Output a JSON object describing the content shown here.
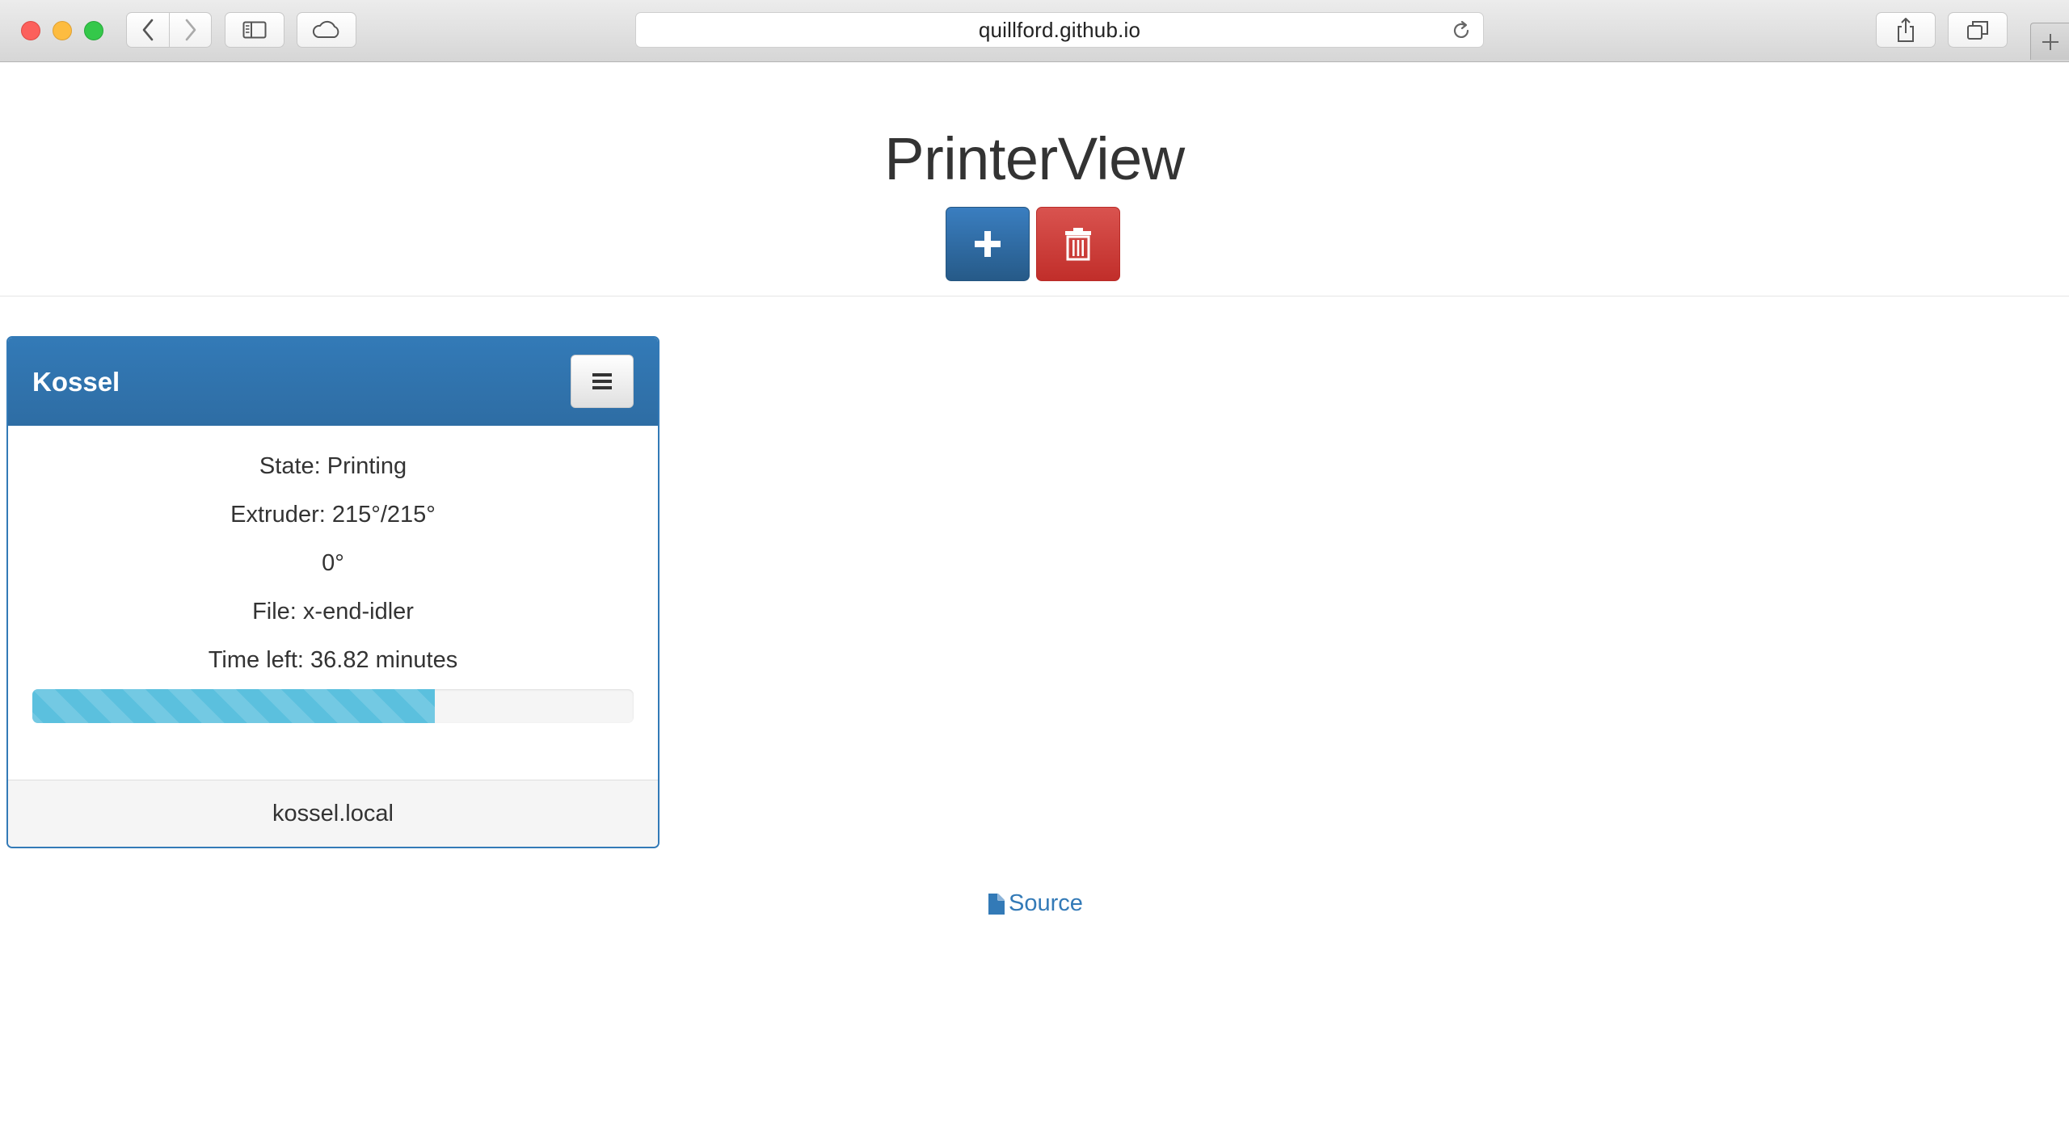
{
  "browser": {
    "url": "quillford.github.io",
    "buttons": {
      "back_icon": "chevron-left-icon",
      "forward_icon": "chevron-right-icon",
      "sidebar_icon": "sidebar-icon",
      "icloud_icon": "cloud-icon",
      "share_icon": "share-icon",
      "tabs_icon": "tabs-icon",
      "reload_icon": "reload-icon",
      "new_tab_icon": "plus-icon"
    }
  },
  "header": {
    "title": "PrinterView",
    "add_icon": "plus-icon",
    "delete_icon": "trash-icon"
  },
  "printers": [
    {
      "name": "Kossel",
      "menu_icon": "hamburger-icon",
      "state": "State: Printing",
      "extruder": "Extruder: 215°/215°",
      "bed": "0°",
      "file": "File: x-end-idler",
      "time_left": "Time left: 36.82 minutes",
      "progress_fraction": 0.67,
      "host": "kossel.local"
    }
  ],
  "footer": {
    "source_label": "Source",
    "source_icon": "file-icon"
  },
  "colors": {
    "primary": "#337ab7",
    "danger": "#d9534f",
    "info": "#5bc0de"
  }
}
